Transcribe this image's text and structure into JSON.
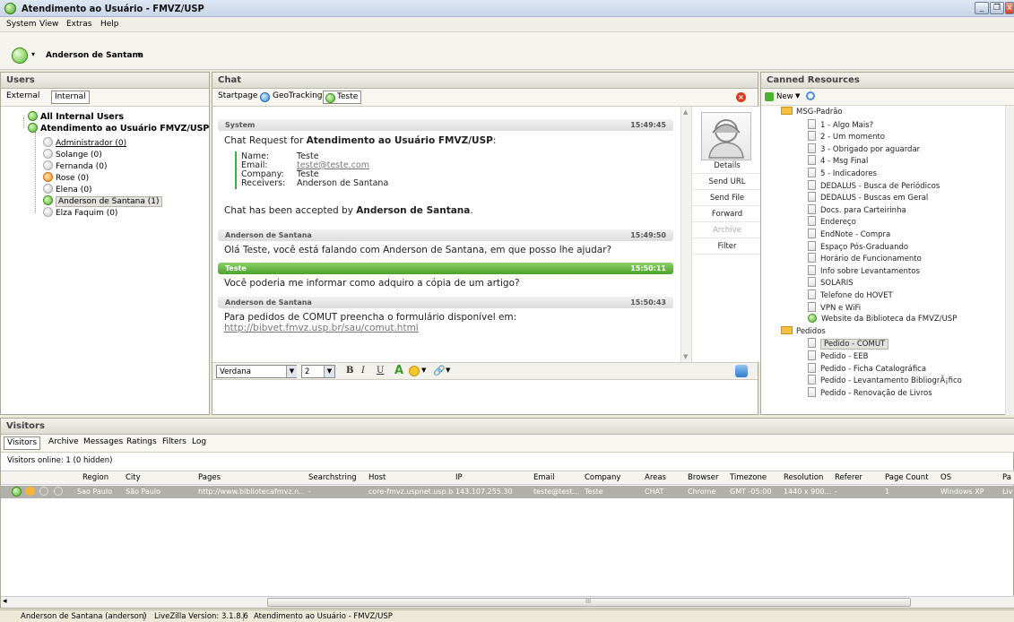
{
  "window": {
    "title": "Atendimento ao Usuário - FMVZ/USP"
  },
  "menu": [
    "System",
    "View",
    "Extras",
    "Help"
  ],
  "user": {
    "name": "Anderson de Santana"
  },
  "users_panel": {
    "title": "Users",
    "tabs": [
      "External",
      "Internal"
    ],
    "root": "All Internal Users",
    "group": "Atendimento ao Usuário FMVZ/USP",
    "members": [
      {
        "label": "Administrador (0)",
        "status": "offline"
      },
      {
        "label": "Solange (0)",
        "status": "offline"
      },
      {
        "label": "Fernanda (0)",
        "status": "offline"
      },
      {
        "label": "Rose (0)",
        "status": "away"
      },
      {
        "label": "Elena (0)",
        "status": "offline"
      },
      {
        "label": "Anderson de Santana (1)",
        "status": "online"
      },
      {
        "label": "Elza Faquim (0)",
        "status": "offline"
      }
    ]
  },
  "chat_panel": {
    "title": "Chat",
    "tabs": [
      "Startpage",
      "GeoTracking",
      "Teste"
    ],
    "messages": {
      "system": {
        "sender": "System",
        "time": "15:49:45",
        "request_prefix": "Chat Request for ",
        "request_target": "Atendimento ao Usuário FMVZ/USP",
        "request_suffix": ":",
        "fields": {
          "name_label": "Name:",
          "name": "Teste",
          "email_label": "Email:",
          "email": "teste@teste.com",
          "company_label": "Company:",
          "company": "Teste",
          "receivers_label": "Receivers:",
          "receivers": "Anderson de Santana"
        },
        "accepted_prefix": "Chat has been accepted by ",
        "accepted_by": "Anderson de Santana",
        "accepted_suffix": "."
      },
      "m1": {
        "sender": "Anderson de Santana",
        "time": "15:49:50",
        "text": "Olá Teste, você está falando com Anderson de Santana, em que posso lhe ajudar?"
      },
      "m2": {
        "sender": "Teste",
        "time": "15:50:11",
        "text": "Você poderia me informar como adquiro a cópia de um artigo?"
      },
      "m3": {
        "sender": "Anderson de Santana",
        "time": "15:50:43",
        "text": "Para pedidos de COMUT preencha o formulário disponível em:",
        "link": "http://bibvet.fmvz.usp.br/sau/comut.html"
      }
    },
    "side_buttons": [
      "Details",
      "Send URL",
      "Send File",
      "Forward",
      "Archive",
      "Filter"
    ],
    "toolbar": {
      "font": "Verdana",
      "size": "2",
      "bold": "B",
      "italic": "I",
      "underline": "U"
    }
  },
  "canned_panel": {
    "title": "Canned Resources",
    "new_label": "New",
    "items": [
      {
        "label": "MSG-Padrão",
        "type": "folder",
        "level": 1
      },
      {
        "label": "1 - Algo Mais?",
        "type": "doc",
        "level": 2
      },
      {
        "label": "2 - Um momento",
        "type": "doc",
        "level": 2
      },
      {
        "label": "3 - Obrigado por aguardar",
        "type": "doc",
        "level": 2
      },
      {
        "label": "4 - Msg Final",
        "type": "doc",
        "level": 2
      },
      {
        "label": "5 - Indicadores",
        "type": "doc",
        "level": 2
      },
      {
        "label": "DEDALUS - Busca de Periódicos",
        "type": "doc",
        "level": 2
      },
      {
        "label": "DEDALUS - Buscas em Geral",
        "type": "doc",
        "level": 2
      },
      {
        "label": "Docs. para Carteirinha",
        "type": "doc",
        "level": 2
      },
      {
        "label": "Endereço",
        "type": "doc",
        "level": 2
      },
      {
        "label": "EndNote - Compra",
        "type": "doc",
        "level": 2
      },
      {
        "label": "Espaço Pós-Graduando",
        "type": "doc",
        "level": 2
      },
      {
        "label": "Horário de Funcionamento",
        "type": "doc",
        "level": 2
      },
      {
        "label": "Info sobre Levantamentos",
        "type": "doc",
        "level": 2
      },
      {
        "label": "SOLARIS",
        "type": "doc",
        "level": 2
      },
      {
        "label": "Telefone do HOVET",
        "type": "doc",
        "level": 2
      },
      {
        "label": "VPN e WiFi",
        "type": "doc",
        "level": 2
      },
      {
        "label": "Website da Biblioteca da FMVZ/USP",
        "type": "web",
        "level": 2
      },
      {
        "label": "Pedidos",
        "type": "folder",
        "level": 1
      },
      {
        "label": "Pedido - COMUT",
        "type": "doc",
        "level": 2,
        "selected": true
      },
      {
        "label": "Pedido - EEB",
        "type": "doc",
        "level": 2
      },
      {
        "label": "Pedido - Ficha Catalográfica",
        "type": "doc",
        "level": 2
      },
      {
        "label": "Pedido - Levantamento BibliogrÃ¡fico",
        "type": "doc",
        "level": 2
      },
      {
        "label": "Pedido - Renovação de Livros",
        "type": "doc",
        "level": 2
      }
    ]
  },
  "visitors_panel": {
    "title": "Visitors",
    "tabs": [
      "Visitors",
      "Archive",
      "Messages",
      "Ratings",
      "Filters",
      "Log"
    ],
    "online": "Visitors online: 1 (0 hidden)",
    "columns": [
      "Region",
      "City",
      "Pages",
      "Searchstring",
      "Host",
      "IP",
      "Email",
      "Company",
      "Areas",
      "Browser",
      "Timezone",
      "Resolution",
      "Referer",
      "Page Count",
      "OS",
      "Pa"
    ],
    "row": [
      "Sao Paulo",
      "São Paulo",
      "http://www.bibliotecafmvz.n...",
      "-",
      "core-fmvz.uspnet.usp.br",
      "143.107.255.30",
      "teste@test...",
      "Teste",
      "CHAT",
      "Chrome",
      "GMT -05:00",
      "1440 x 900...",
      "-",
      "1",
      "Windows XP",
      "Liv"
    ],
    "scroll_mark": "III"
  },
  "statusbar": [
    "Anderson de Santana (anderson)",
    "LiveZilla Version: 3.1.8.6",
    "Atendimento ao Usuário - FMVZ/USP"
  ]
}
